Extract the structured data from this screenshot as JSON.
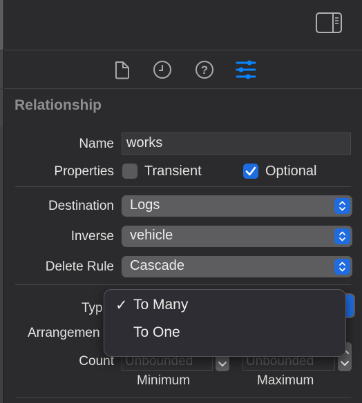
{
  "toolbar": {
    "inspector_toggle_icon": "sidebar-right-icon"
  },
  "inspector_tabs": [
    {
      "name": "file-inspector",
      "icon": "document-icon",
      "active": false
    },
    {
      "name": "history-inspector",
      "icon": "clock-icon",
      "active": false
    },
    {
      "name": "quick-help",
      "icon": "question-circle-icon",
      "active": false
    },
    {
      "name": "attributes-inspector",
      "icon": "sliders-icon",
      "active": true
    }
  ],
  "accent_color": "#0a84ff",
  "section": {
    "title": "Relationship"
  },
  "fields": {
    "name": {
      "label": "Name",
      "value": "works"
    },
    "properties": {
      "label": "Properties",
      "transient": {
        "label": "Transient",
        "checked": false
      },
      "optional": {
        "label": "Optional",
        "checked": true
      }
    },
    "destination": {
      "label": "Destination",
      "value": "Logs"
    },
    "inverse": {
      "label": "Inverse",
      "value": "vehicle"
    },
    "delete_rule": {
      "label": "Delete Rule",
      "value": "Cascade"
    },
    "type": {
      "label": "Type",
      "label_visible": "Typ"
    },
    "arrangement": {
      "label": "Arrangement",
      "label_visible": "Arrangemen"
    },
    "count": {
      "label": "Count",
      "minimum": {
        "placeholder": "Unbounded",
        "sub_label": "Minimum"
      },
      "maximum": {
        "placeholder": "Unbounded",
        "sub_label": "Maximum"
      }
    }
  },
  "type_menu": {
    "items": [
      {
        "label": "To Many",
        "checked": true,
        "check_glyph": "✓"
      },
      {
        "label": "To One",
        "checked": false,
        "check_glyph": ""
      }
    ]
  }
}
